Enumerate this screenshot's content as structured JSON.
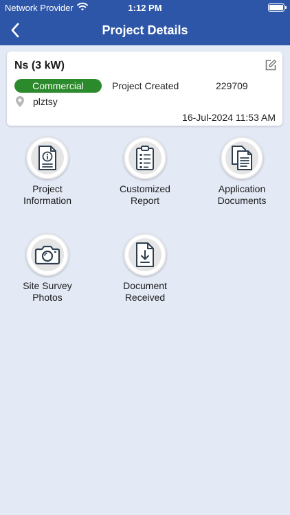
{
  "status_bar": {
    "carrier": "Network Provider",
    "time": "1:12 PM"
  },
  "nav": {
    "title": "Project Details"
  },
  "project": {
    "title": "Ns (3 kW)",
    "type": "Commercial",
    "status": "Project Created",
    "id": "229709",
    "location": "plztsy",
    "date": "16-Jul-2024 11:53 AM"
  },
  "tiles": [
    {
      "line1": "Project",
      "line2": "Information",
      "icon": "document-info-icon"
    },
    {
      "line1": "Customized",
      "line2": "Report",
      "icon": "clipboard-checklist-icon"
    },
    {
      "line1": "Application",
      "line2": "Documents",
      "icon": "documents-stack-icon"
    },
    {
      "line1": "Site Survey",
      "line2": "Photos",
      "icon": "camera-icon"
    },
    {
      "line1": "Document",
      "line2": "Received",
      "icon": "document-download-icon"
    }
  ],
  "colors": {
    "nav_bg": "#2d56a8",
    "page_bg": "#e3e9f5",
    "badge_green": "#2b8a2b",
    "icon_dark": "#2c3e50"
  }
}
